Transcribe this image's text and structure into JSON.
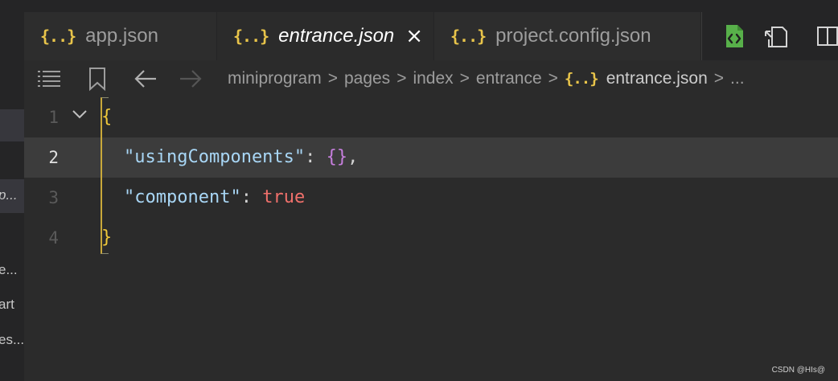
{
  "left_panel": {
    "fragments": [
      "p...",
      "e...",
      "art",
      "es..."
    ]
  },
  "tabs": [
    {
      "icon": "{..}",
      "label": "app.json",
      "active": false
    },
    {
      "icon": "{..}",
      "label": "entrance.json",
      "active": true,
      "close": "×"
    },
    {
      "icon": "{..}",
      "label": "project.config.json",
      "active": false
    }
  ],
  "breadcrumb": {
    "segments": [
      "miniprogram",
      "pages",
      "index",
      "entrance"
    ],
    "file_icon": "{..}",
    "file": "entrance.json",
    "tail": "...",
    "separator": ">"
  },
  "editor": {
    "current_line": 2,
    "lines": [
      {
        "number": "1",
        "brace": "{"
      },
      {
        "number": "2",
        "key": "\"usingComponents\"",
        "colon": ": ",
        "value": "{}",
        "comma": ","
      },
      {
        "number": "3",
        "key": "\"component\"",
        "colon": ": ",
        "value": "true"
      },
      {
        "number": "4",
        "brace": "}"
      }
    ]
  },
  "watermark": "CSDN @HIs@",
  "colors": {
    "json_icon": "#e8c44a",
    "key": "#a8d6f5",
    "object": "#c77fde",
    "boolean": "#f0706b",
    "current_line_bg": "#3c3c3c",
    "green_file_icon": "#58b04a"
  }
}
